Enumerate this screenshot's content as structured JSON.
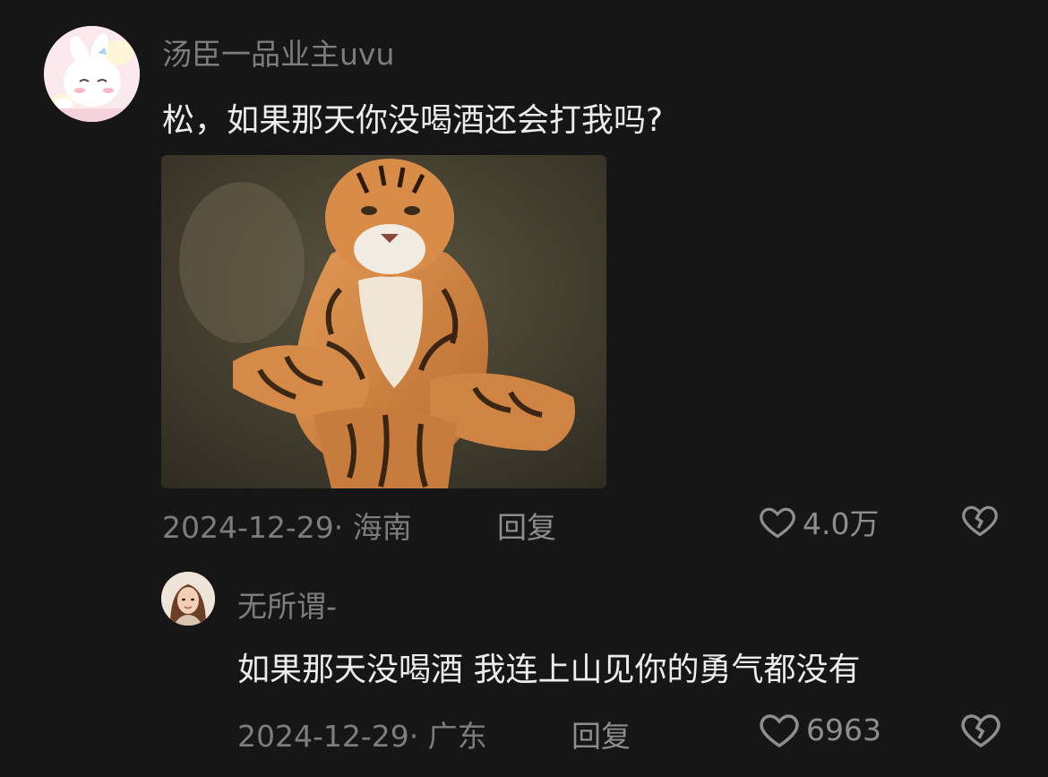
{
  "comments": [
    {
      "username": "汤臣一品业主uvu",
      "text": "松，如果那天你没喝酒还会打我吗?",
      "date": "2024-12-29",
      "location": "海南",
      "reply_label": "回复",
      "likes": "4.0万",
      "image_icon": "tiger-sitting-image"
    },
    {
      "username": "无所谓-",
      "text": "如果那天没喝酒 我连上山见你的勇气都没有",
      "date": "2024-12-29",
      "location": "广东",
      "reply_label": "回复",
      "likes": "6963"
    }
  ],
  "separator": "·",
  "colors": {
    "background": "#161616",
    "text": "#ececec",
    "muted": "#7d7d7d"
  }
}
